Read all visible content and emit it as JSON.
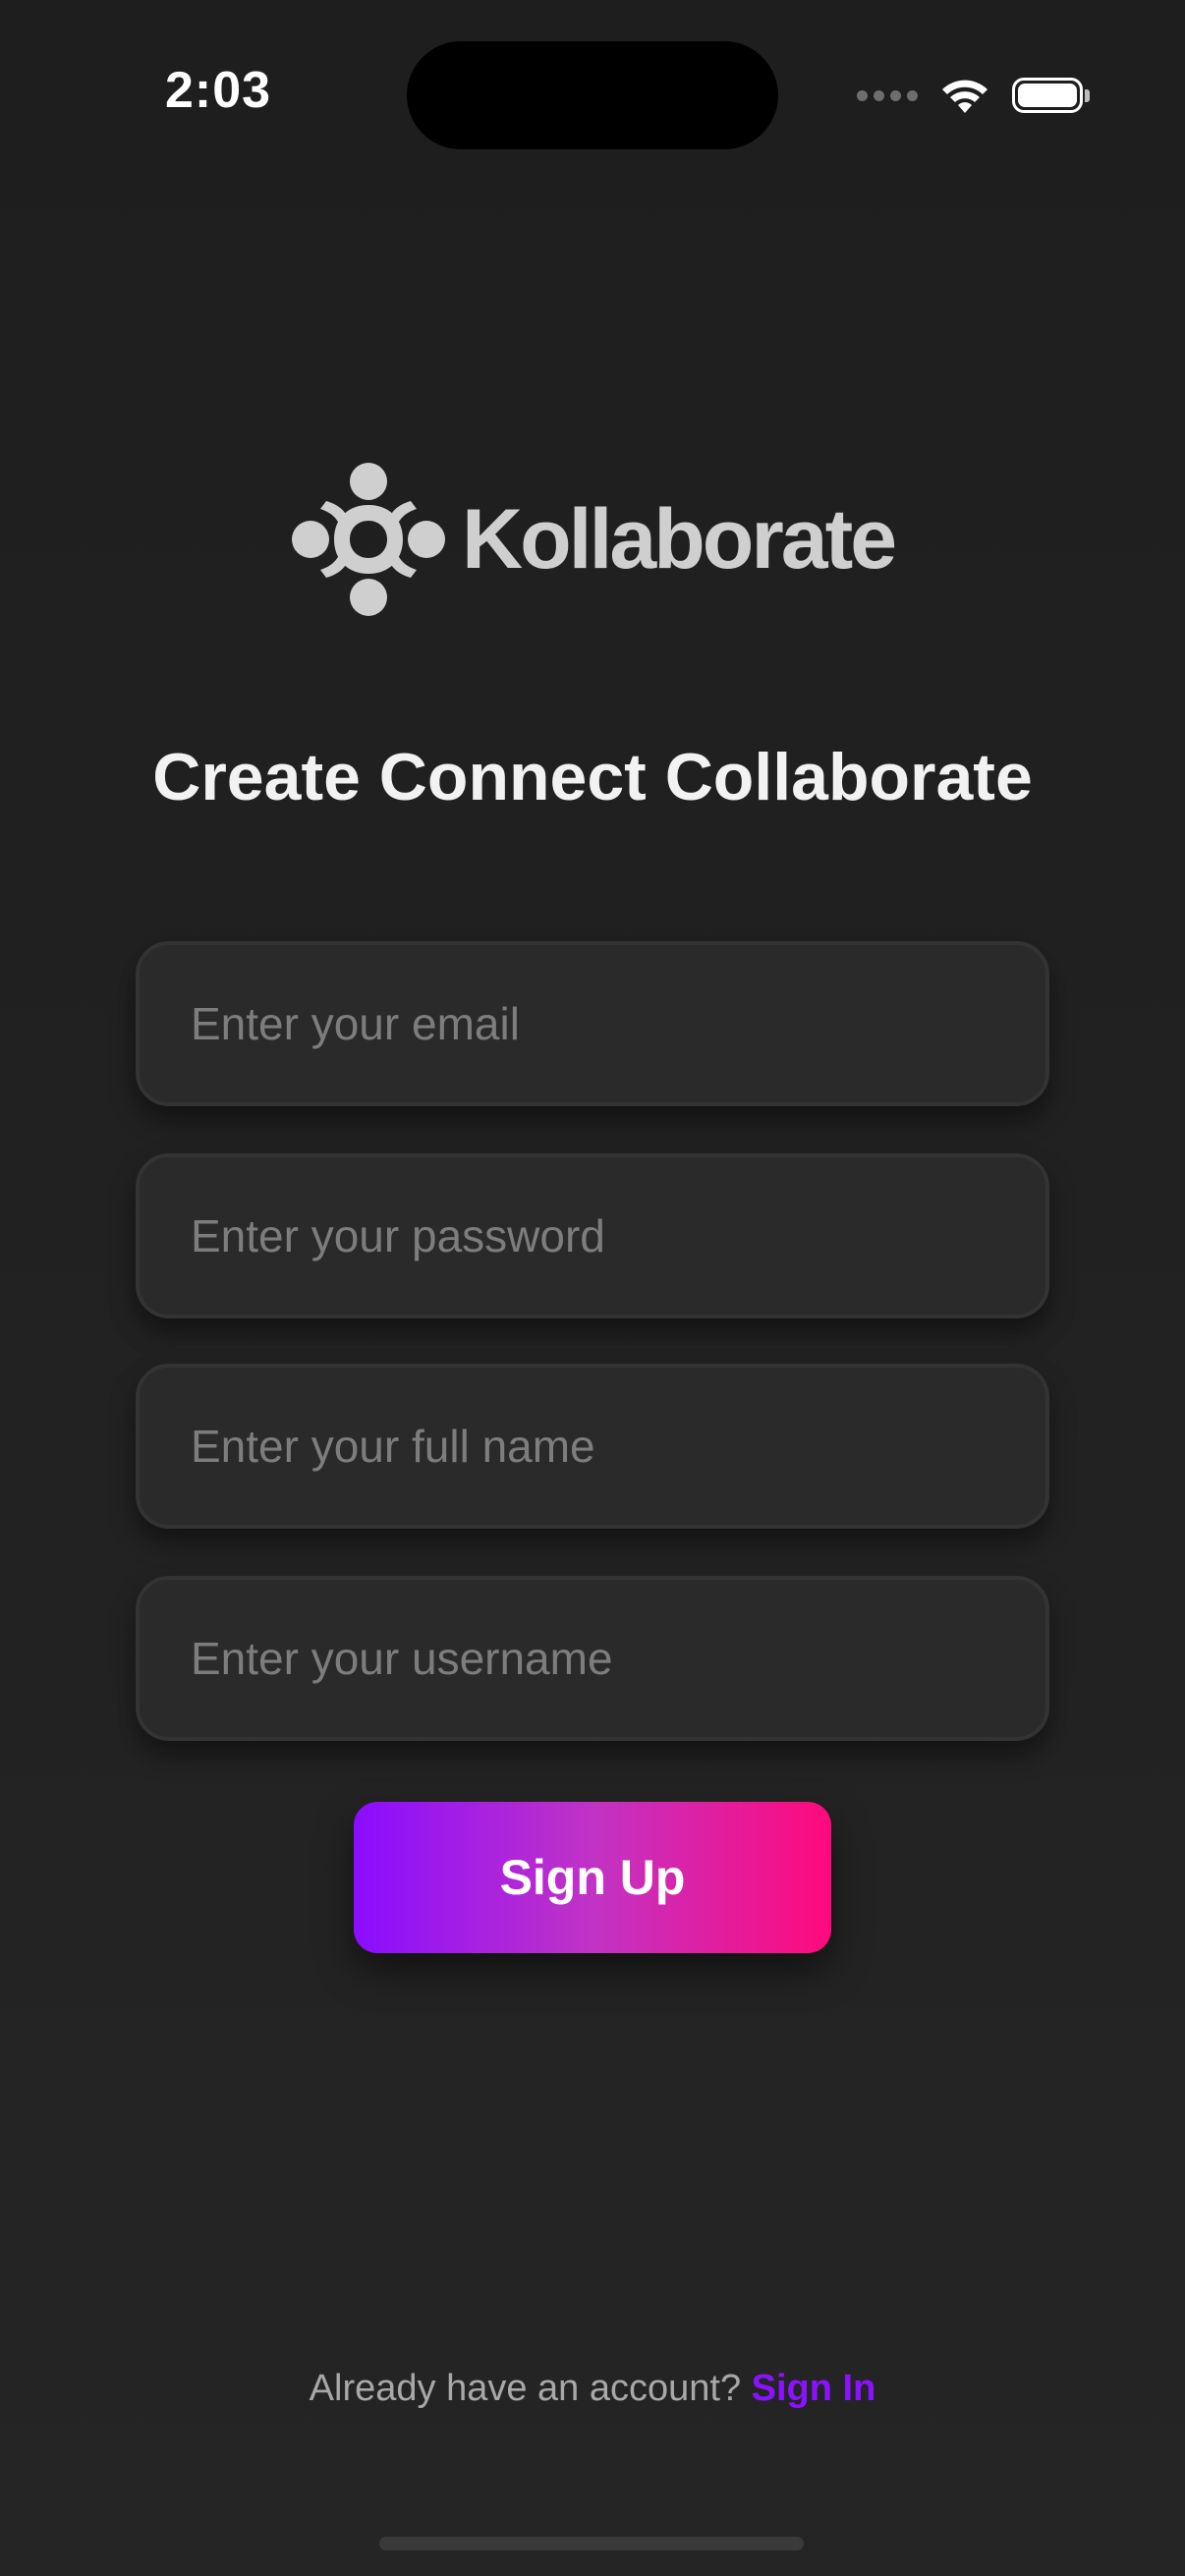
{
  "status_bar": {
    "time": "2:03",
    "icons": [
      "cellular-signal-icon",
      "wifi-icon",
      "battery-icon"
    ]
  },
  "brand": {
    "name": "Kollaborate",
    "logo_icon": "people-circle-logo-icon"
  },
  "tagline": "Create Connect Collaborate",
  "form": {
    "email_placeholder": "Enter your email",
    "password_placeholder": "Enter your password",
    "fullname_placeholder": "Enter your full name",
    "username_placeholder": "Enter your username",
    "signup_label": "Sign Up"
  },
  "footer": {
    "prompt": "Already have an account?",
    "signin_label": "Sign In"
  },
  "colors": {
    "background": "#212121",
    "field_background": "#2a2a2a",
    "accent_purple": "#8a12ff",
    "accent_pink": "#ff0a7c",
    "logo_gray": "#cfcfcf"
  }
}
